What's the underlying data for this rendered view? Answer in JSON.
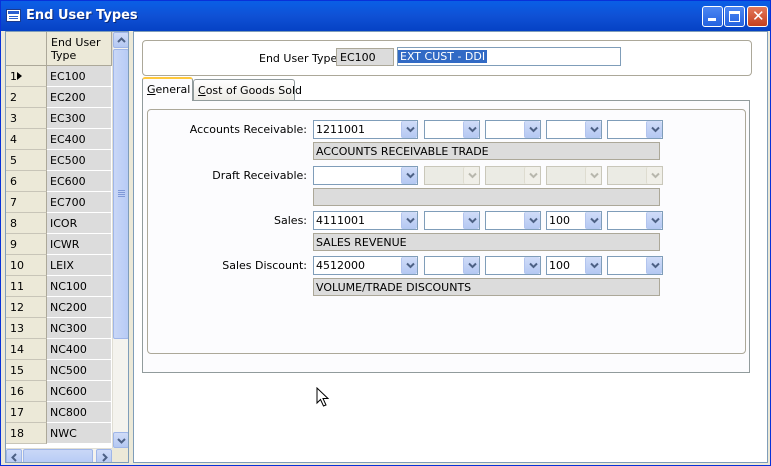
{
  "window": {
    "title": "End User Types"
  },
  "grid": {
    "column_header": [
      "End User",
      "Type"
    ],
    "current_row": 1,
    "rows": [
      {
        "num": "1",
        "type": "EC100"
      },
      {
        "num": "2",
        "type": "EC200"
      },
      {
        "num": "3",
        "type": "EC300"
      },
      {
        "num": "4",
        "type": "EC400"
      },
      {
        "num": "5",
        "type": "EC500"
      },
      {
        "num": "6",
        "type": "EC600"
      },
      {
        "num": "7",
        "type": "EC700"
      },
      {
        "num": "8",
        "type": "ICOR"
      },
      {
        "num": "9",
        "type": "ICWR"
      },
      {
        "num": "10",
        "type": "LEIX"
      },
      {
        "num": "11",
        "type": "NC100"
      },
      {
        "num": "12",
        "type": "NC200"
      },
      {
        "num": "13",
        "type": "NC300"
      },
      {
        "num": "14",
        "type": "NC400"
      },
      {
        "num": "15",
        "type": "NC500"
      },
      {
        "num": "16",
        "type": "NC600"
      },
      {
        "num": "17",
        "type": "NC800"
      },
      {
        "num": "18",
        "type": "NWC"
      }
    ]
  },
  "header": {
    "label": "End User Type:",
    "code": "EC100",
    "description": "EXT CUST - DDI"
  },
  "tabs": [
    {
      "label_underlined": "G",
      "label_rest": "eneral",
      "active": true
    },
    {
      "label_underlined": "C",
      "label_rest": "ost of Goods Sold",
      "active": false
    }
  ],
  "fields": {
    "accounts_receivable": {
      "label": "Accounts Receivable:",
      "values": [
        "1211001",
        "",
        "",
        "",
        ""
      ],
      "description": "ACCOUNTS RECEIVABLE TRADE",
      "disabled": [
        false,
        false,
        false,
        false,
        false
      ]
    },
    "draft_receivable": {
      "label": "Draft Receivable:",
      "values": [
        "",
        "",
        "",
        "",
        ""
      ],
      "description": "",
      "disabled": [
        false,
        true,
        true,
        true,
        true
      ]
    },
    "sales": {
      "label": "Sales:",
      "values": [
        "4111001",
        "",
        "",
        "100",
        ""
      ],
      "description": "SALES REVENUE",
      "disabled": [
        false,
        false,
        false,
        false,
        false
      ]
    },
    "sales_discount": {
      "label": "Sales Discount:",
      "values": [
        "4512000",
        "",
        "",
        "100",
        ""
      ],
      "description": "VOLUME/TRADE DISCOUNTS",
      "disabled": [
        false,
        false,
        false,
        false,
        false
      ]
    }
  }
}
